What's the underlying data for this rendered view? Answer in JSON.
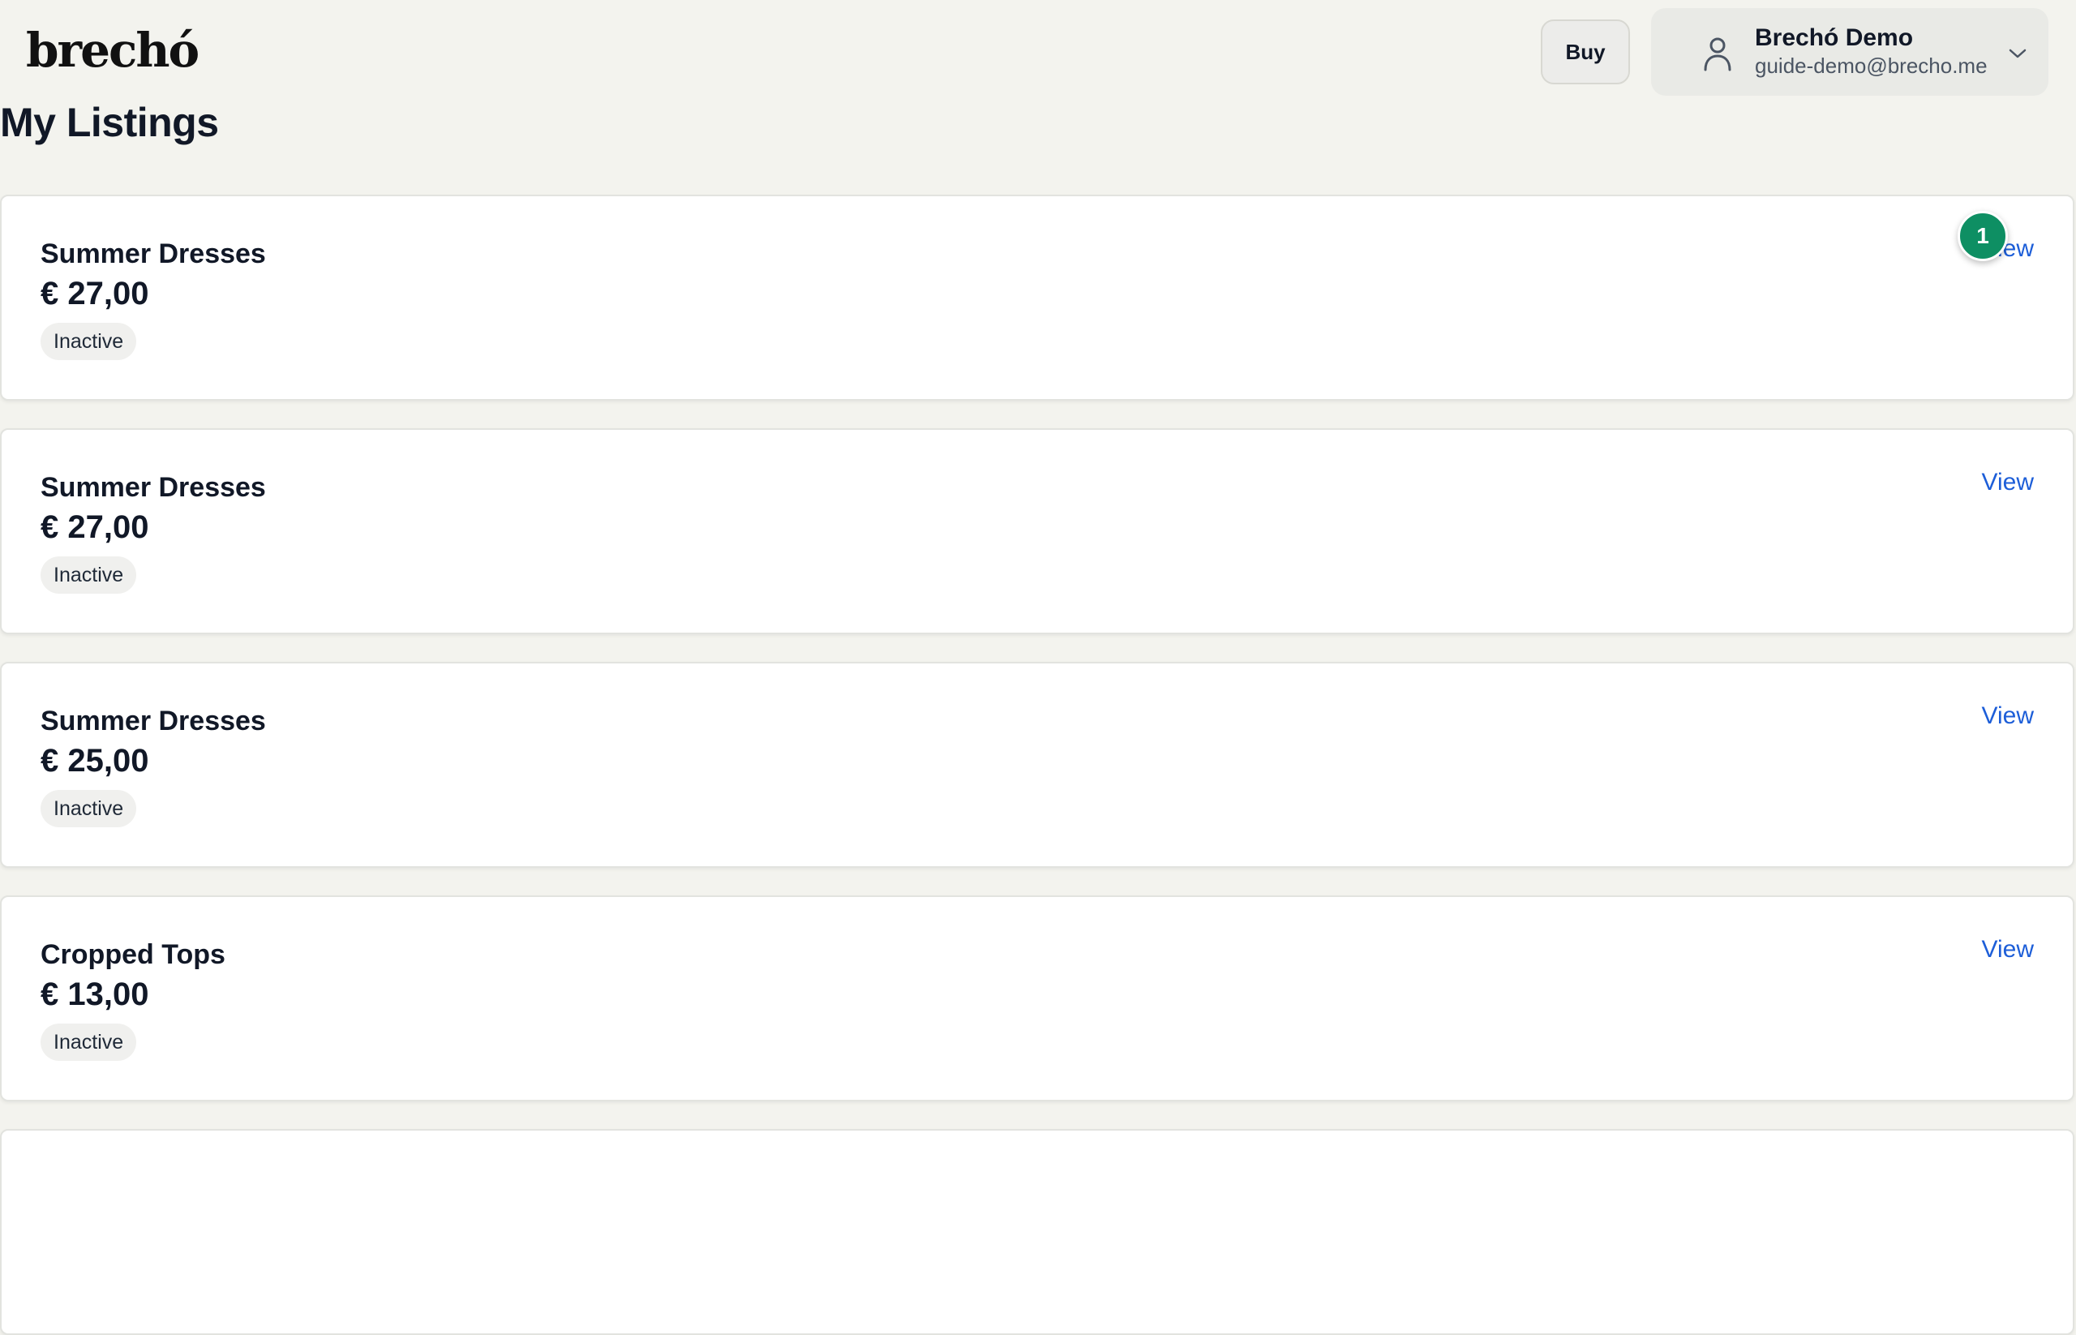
{
  "header": {
    "logo": "brechó",
    "buy_label": "Buy",
    "user": {
      "name": "Brechó Demo",
      "email": "guide-demo@brecho.me",
      "icon": "user-icon",
      "menu_icon": "chevron-down-icon"
    }
  },
  "page": {
    "title": "My Listings"
  },
  "listings": [
    {
      "title": "Summer Dresses",
      "price": "€ 27,00",
      "status": "Inactive",
      "action": "View"
    },
    {
      "title": "Summer Dresses",
      "price": "€ 27,00",
      "status": "Inactive",
      "action": "View"
    },
    {
      "title": "Summer Dresses",
      "price": "€ 25,00",
      "status": "Inactive",
      "action": "View"
    },
    {
      "title": "Cropped Tops",
      "price": "€ 13,00",
      "status": "Inactive",
      "action": "View"
    },
    {
      "title": "",
      "price": "",
      "status": "",
      "action": ""
    }
  ],
  "guide": {
    "step_number": "1",
    "step_color": "#0e8f63"
  },
  "colors": {
    "background": "#f3f3ee",
    "link": "#1d5ed8",
    "text": "#111827"
  }
}
